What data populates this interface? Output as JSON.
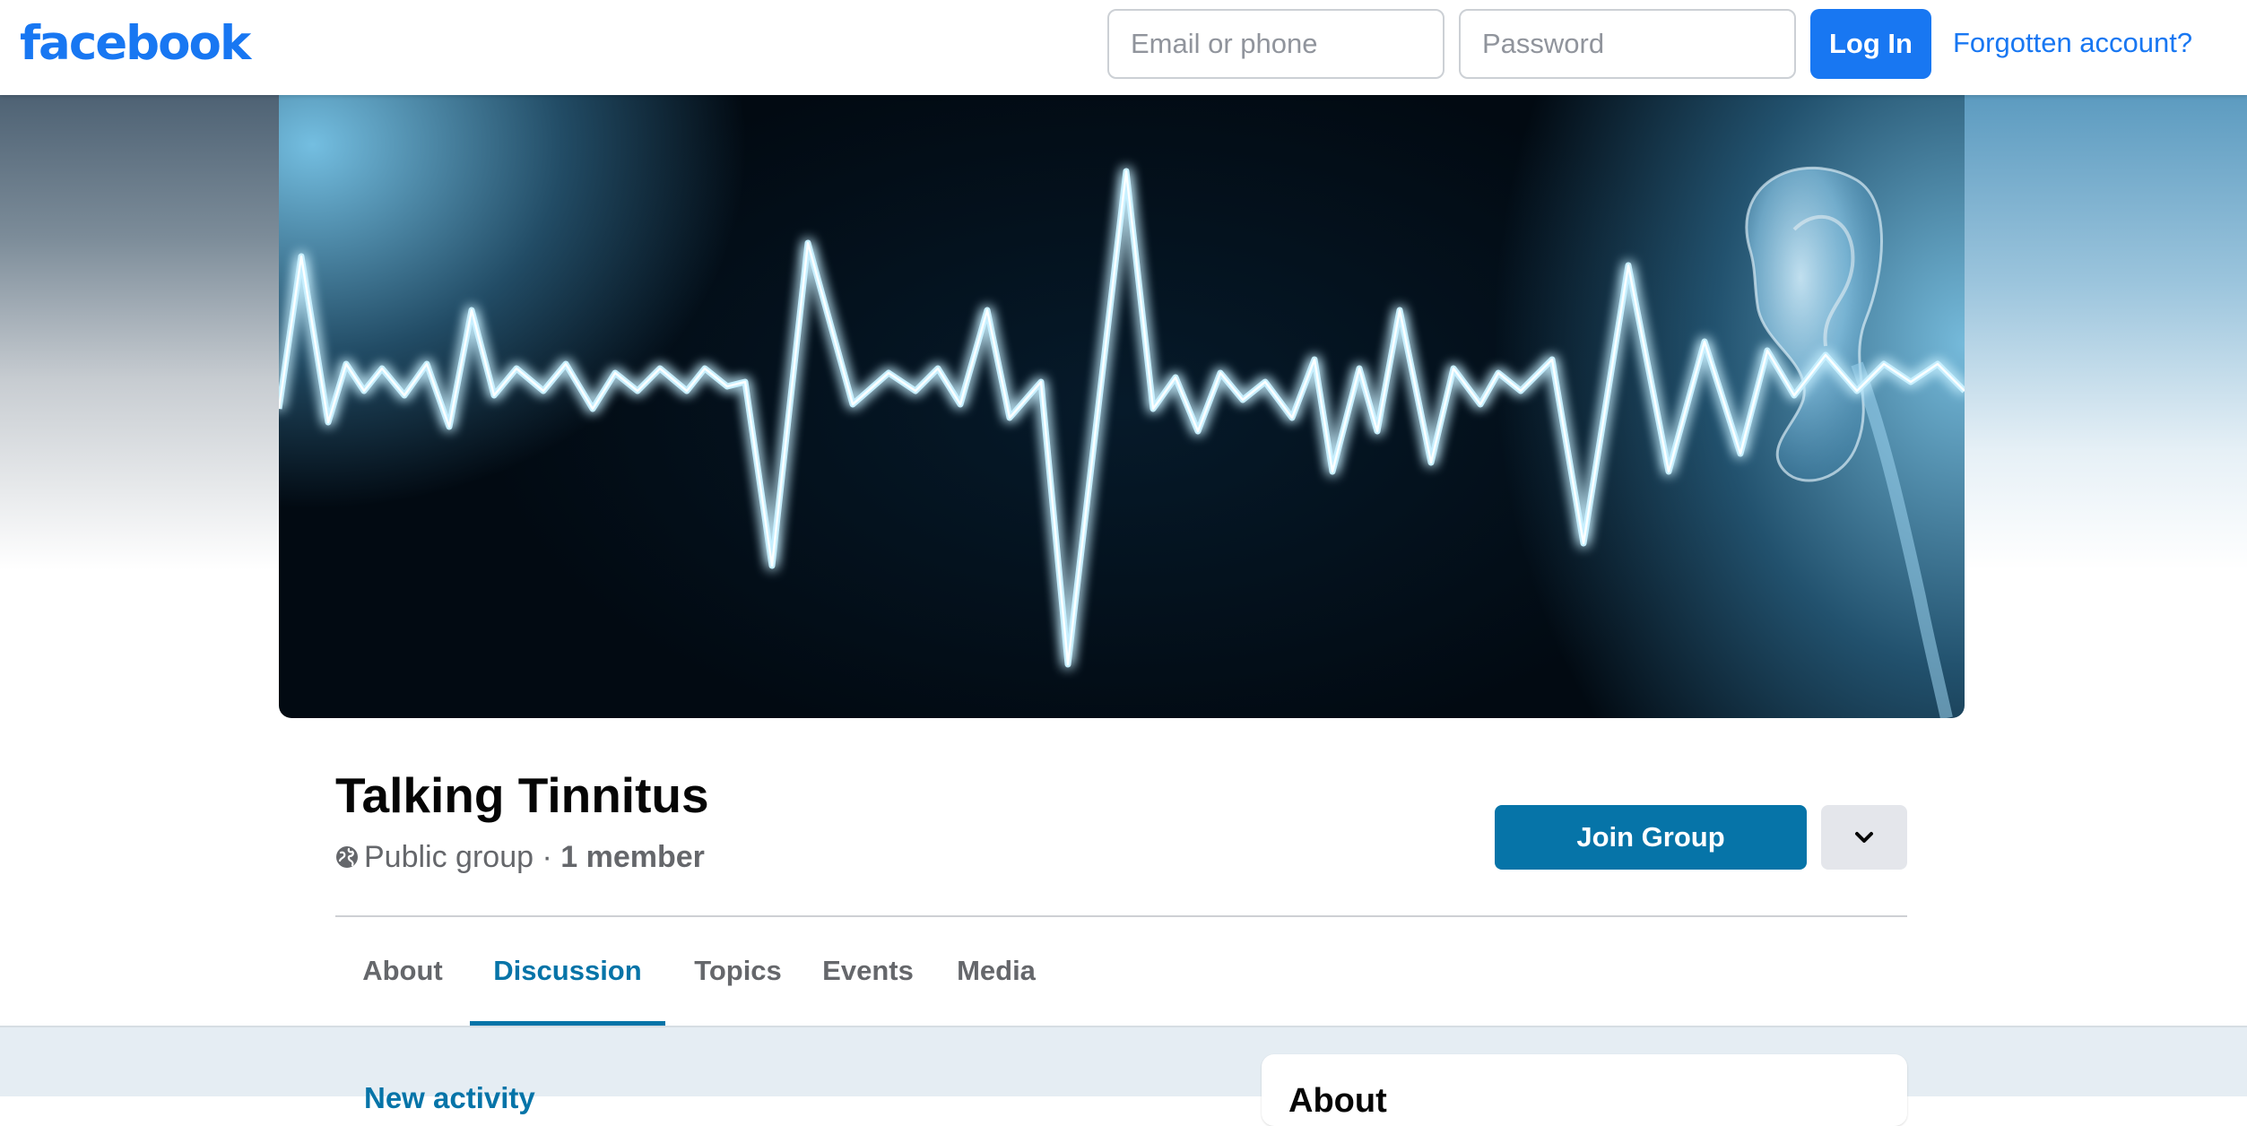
{
  "header": {
    "logo": "facebook",
    "email_placeholder": "Email or phone",
    "password_placeholder": "Password",
    "login_label": "Log In",
    "forgot_label": "Forgotten account?"
  },
  "group": {
    "name": "Talking Tinnitus",
    "privacy": "Public group",
    "separator": " · ",
    "members": "1 member",
    "join_label": "Join Group"
  },
  "tabs": [
    {
      "label": "About",
      "active": false
    },
    {
      "label": "Discussion",
      "active": true
    },
    {
      "label": "Topics",
      "active": false
    },
    {
      "label": "Events",
      "active": false
    },
    {
      "label": "Media",
      "active": false
    }
  ],
  "content": {
    "activity_label": "New activity",
    "about_title": "About"
  },
  "colors": {
    "brand": "#1877f2",
    "group_accent": "#0674a8",
    "cover_wave": "#bfeaff"
  },
  "icons": {
    "privacy": "globe-icon",
    "more": "chevron-down-icon",
    "cover": "sound-wave-ear-image"
  }
}
